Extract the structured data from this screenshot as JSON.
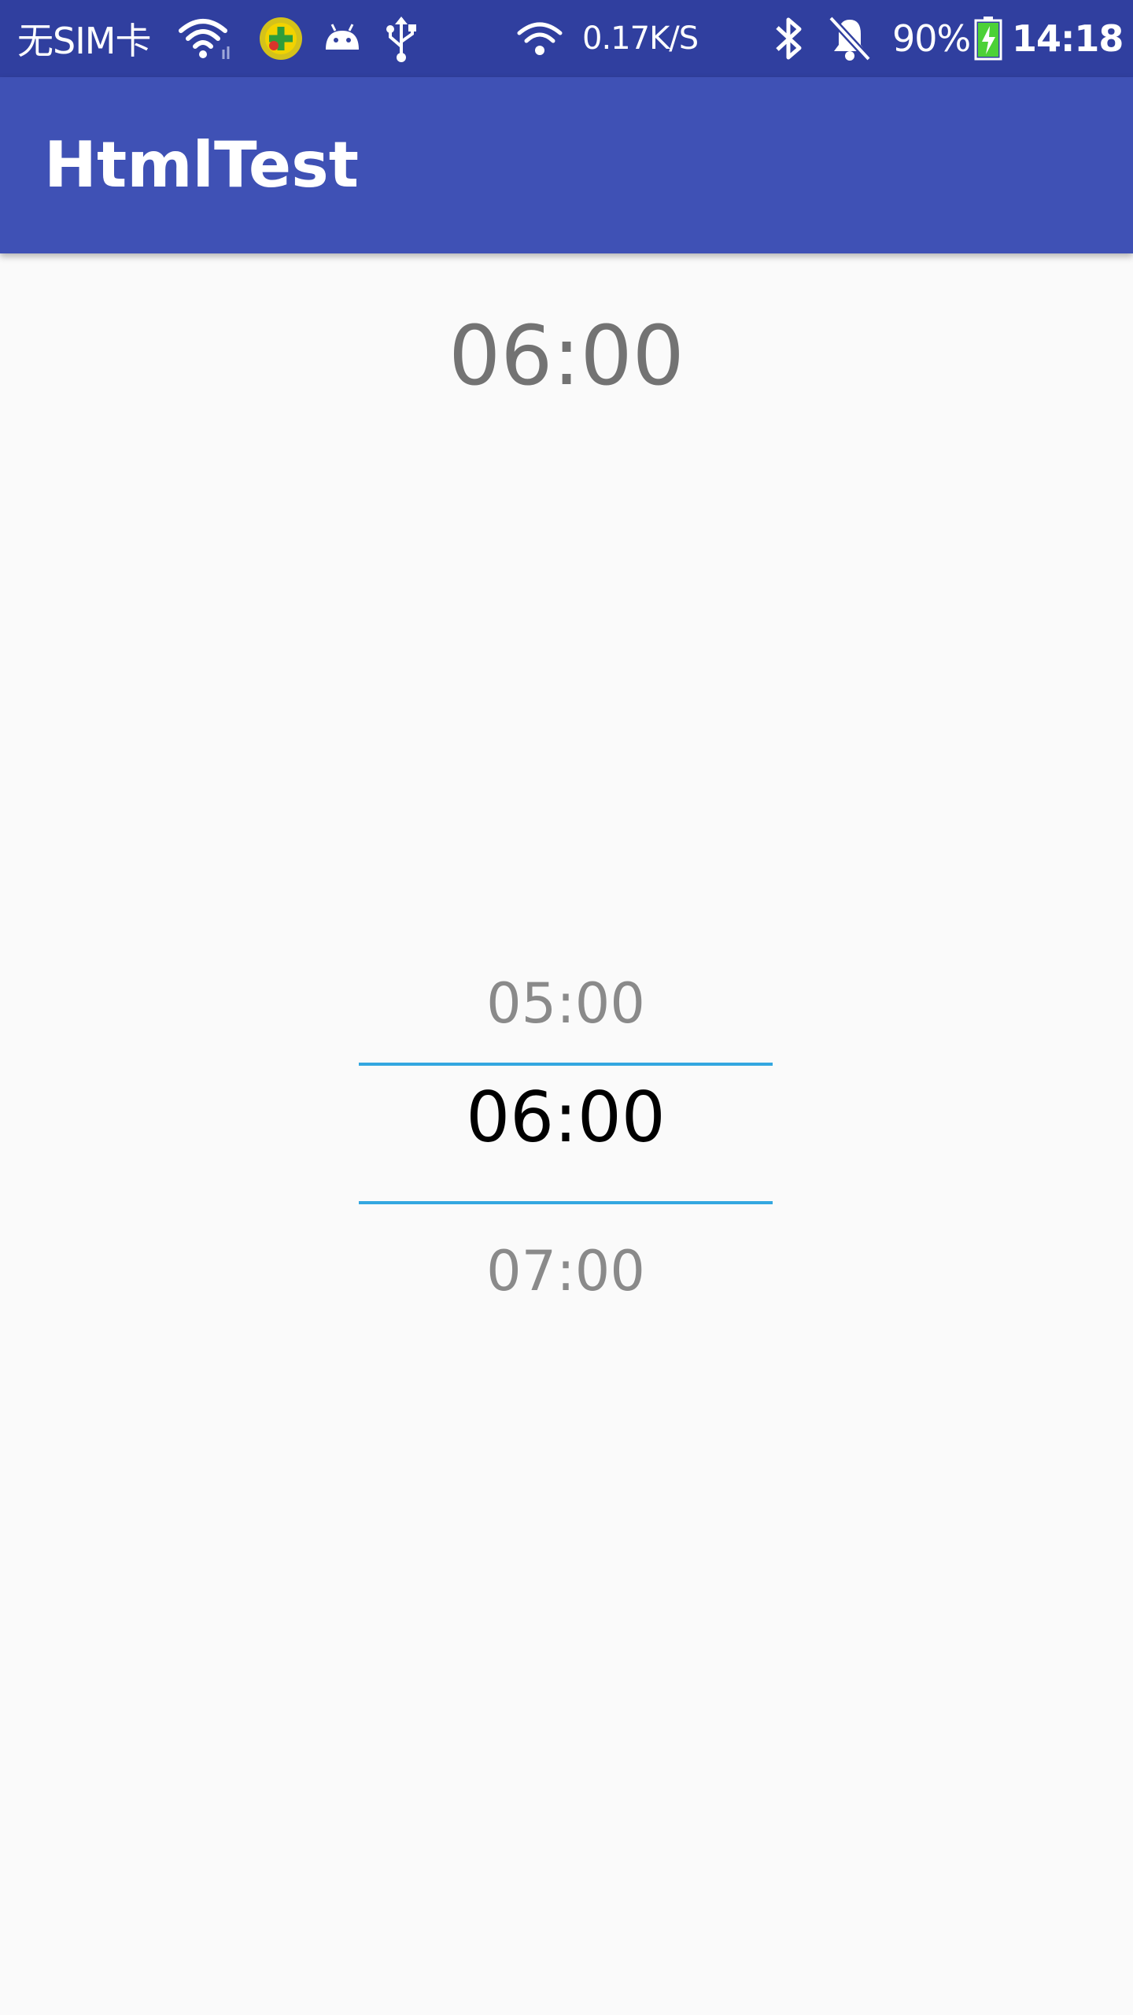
{
  "status_bar": {
    "carrier": "无SIM卡",
    "network_speed": "0.17K/S",
    "battery_percent": "90%",
    "time": "14:18",
    "icons": [
      "wifi-icon",
      "app-notification-icon",
      "android-icon",
      "usb-icon",
      "wifi-hotspot-icon",
      "bluetooth-icon",
      "notifications-off-icon",
      "battery-charging-icon"
    ],
    "battery_level": 0.9,
    "colors": {
      "background": "#303f9f",
      "battery_fill": "#4cd137"
    }
  },
  "app_bar": {
    "title": "HtmlTest",
    "color": "#3f51b5"
  },
  "selected_time": "06:00",
  "time_picker": {
    "previous": "05:00",
    "current": "06:00",
    "next": "07:00",
    "divider_color": "#33a7e0"
  }
}
